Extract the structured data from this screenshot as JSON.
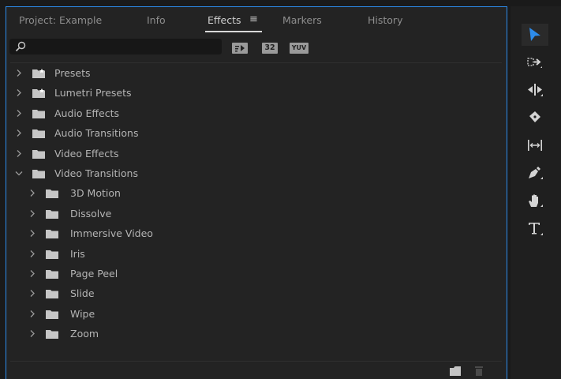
{
  "tabs": [
    {
      "label": "Project: Example",
      "active": false
    },
    {
      "label": "Info",
      "active": false
    },
    {
      "label": "Effects",
      "active": true
    },
    {
      "label": "Markers",
      "active": false
    },
    {
      "label": "History",
      "active": false
    }
  ],
  "effects_menu_icon": "hamburger-menu-icon",
  "search": {
    "value": "",
    "placeholder": ""
  },
  "filters": {
    "accelerated_icon": "accelerated-effects-icon",
    "bit32_label": "32",
    "yuv_label": "YUV"
  },
  "tree": [
    {
      "label": "Presets",
      "level": 0,
      "expanded": false,
      "icon": "preset-folder-icon"
    },
    {
      "label": "Lumetri Presets",
      "level": 0,
      "expanded": false,
      "icon": "preset-folder-icon"
    },
    {
      "label": "Audio Effects",
      "level": 0,
      "expanded": false,
      "icon": "folder-icon"
    },
    {
      "label": "Audio Transitions",
      "level": 0,
      "expanded": false,
      "icon": "folder-icon"
    },
    {
      "label": "Video Effects",
      "level": 0,
      "expanded": false,
      "icon": "folder-icon"
    },
    {
      "label": "Video Transitions",
      "level": 0,
      "expanded": true,
      "icon": "folder-icon"
    },
    {
      "label": "3D Motion",
      "level": 1,
      "expanded": false,
      "icon": "folder-icon"
    },
    {
      "label": "Dissolve",
      "level": 1,
      "expanded": false,
      "icon": "folder-icon"
    },
    {
      "label": "Immersive Video",
      "level": 1,
      "expanded": false,
      "icon": "folder-icon"
    },
    {
      "label": "Iris",
      "level": 1,
      "expanded": false,
      "icon": "folder-icon"
    },
    {
      "label": "Page Peel",
      "level": 1,
      "expanded": false,
      "icon": "folder-icon"
    },
    {
      "label": "Slide",
      "level": 1,
      "expanded": false,
      "icon": "folder-icon"
    },
    {
      "label": "Wipe",
      "level": 1,
      "expanded": false,
      "icon": "folder-icon"
    },
    {
      "label": "Zoom",
      "level": 1,
      "expanded": false,
      "icon": "folder-icon"
    }
  ],
  "bottom_icons": [
    "new-bin-icon",
    "delete-icon"
  ],
  "tools": [
    {
      "name": "selection-tool-icon",
      "active": true
    },
    {
      "name": "track-select-forward-tool-icon",
      "active": false
    },
    {
      "name": "ripple-edit-tool-icon",
      "active": false
    },
    {
      "name": "razor-tool-icon",
      "active": false
    },
    {
      "name": "slip-tool-icon",
      "active": false
    },
    {
      "name": "pen-tool-icon",
      "active": false
    },
    {
      "name": "hand-tool-icon",
      "active": false
    },
    {
      "name": "type-tool-icon",
      "active": false
    }
  ],
  "colors": {
    "accent": "#2d8ceb",
    "panel_bg": "#232323",
    "text": "#b4b4b4",
    "icon": "#d4d4d4"
  }
}
